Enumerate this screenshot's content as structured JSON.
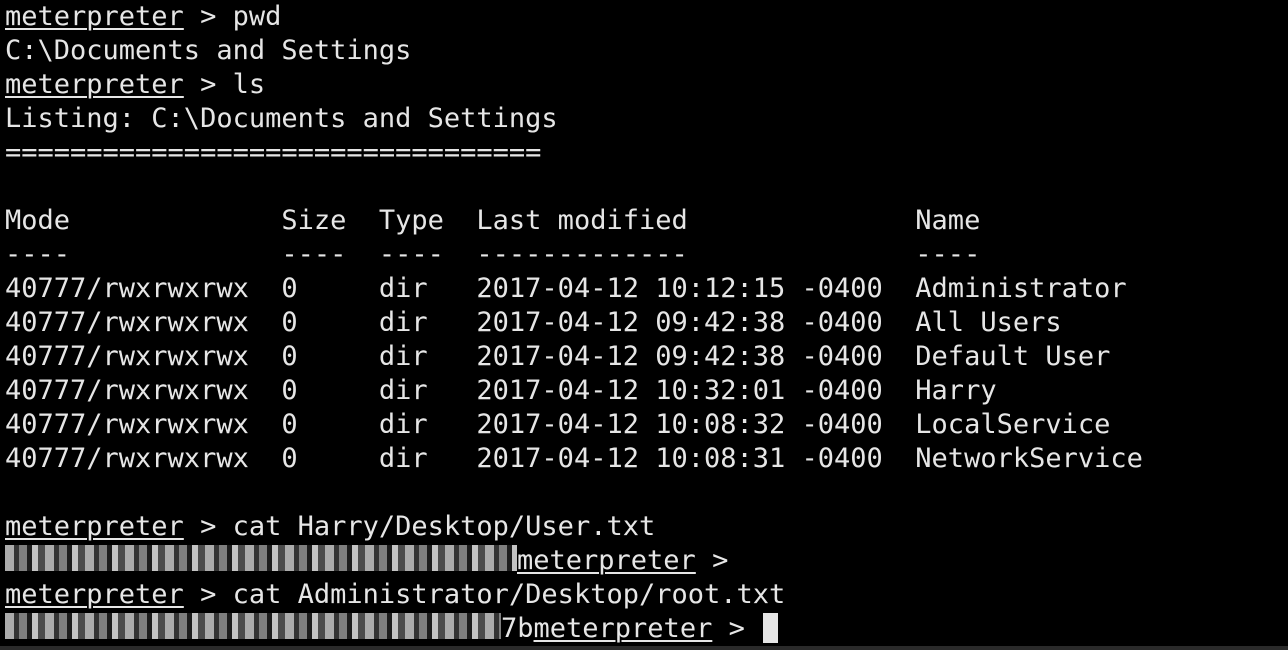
{
  "terminal": {
    "prompt": "meterpreter",
    "lines": [
      {
        "cmd": " > pwd"
      },
      {
        "text": "C:\\Documents and Settings"
      },
      {
        "cmd": " > ls"
      },
      {
        "text": "Listing: C:\\Documents and Settings"
      },
      {
        "text": "================================="
      },
      {
        "text": ""
      },
      {
        "text": "Mode             Size  Type  Last modified              Name"
      },
      {
        "text": "----             ----  ----  -------------              ----"
      },
      {
        "text": "40777/rwxrwxrwx  0     dir   2017-04-12 10:12:15 -0400  Administrator"
      },
      {
        "text": "40777/rwxrwxrwx  0     dir   2017-04-12 09:42:38 -0400  All Users"
      },
      {
        "text": "40777/rwxrwxrwx  0     dir   2017-04-12 09:42:38 -0400  Default User"
      },
      {
        "text": "40777/rwxrwxrwx  0     dir   2017-04-12 10:32:01 -0400  Harry"
      },
      {
        "text": "40777/rwxrwxrwx  0     dir   2017-04-12 10:08:32 -0400  LocalService"
      },
      {
        "text": "40777/rwxrwxrwx  0     dir   2017-04-12 10:08:31 -0400  NetworkService"
      },
      {
        "text": ""
      },
      {
        "cmd": " > cat Harry/Desktop/User.txt"
      },
      {
        "cmd2": " >"
      },
      {
        "cmd": " > cat Administrator/Desktop/root.txt"
      },
      {
        "tail": "7b",
        "cmd3": " > "
      }
    ]
  }
}
